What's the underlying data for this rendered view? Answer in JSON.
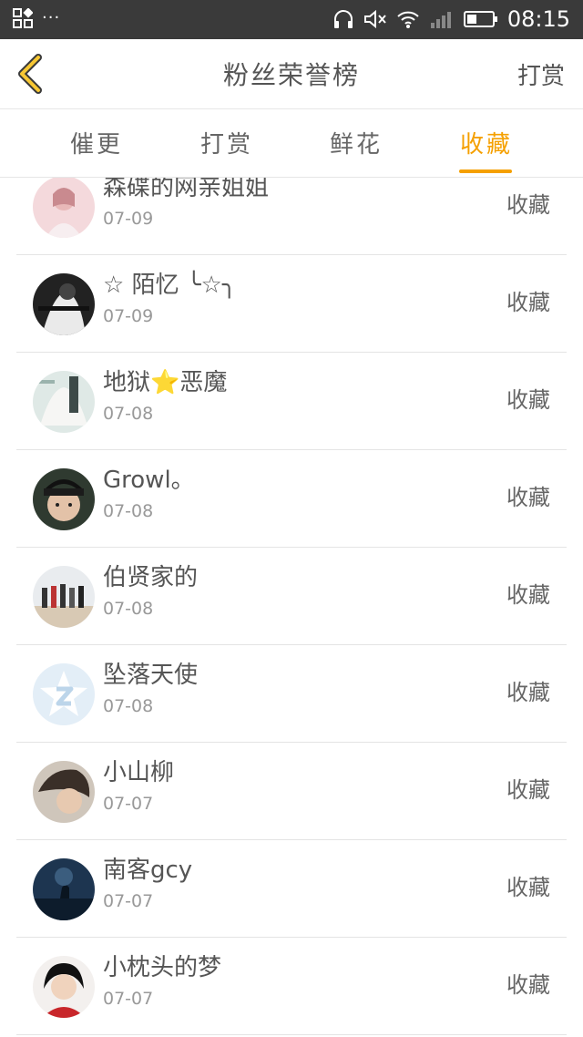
{
  "status_bar": {
    "time": "08:15",
    "left_dots": "···"
  },
  "header": {
    "title": "粉丝荣誉榜",
    "right_link": "打赏"
  },
  "tabs": [
    {
      "label": "催更"
    },
    {
      "label": "打赏"
    },
    {
      "label": "鲜花"
    },
    {
      "label": "收藏"
    }
  ],
  "active_tab": "收藏",
  "colors": {
    "accent": "#f5a000",
    "status_bar": "#3a3a3a"
  },
  "rows": [
    {
      "name": "森碟的网亲姐姐",
      "date": "07-09",
      "action": "收藏"
    },
    {
      "name": "☆ 陌忆 ╰☆╮",
      "date": "07-09",
      "action": "收藏"
    },
    {
      "name": "地狱⭐恶魔",
      "date": "07-08",
      "action": "收藏"
    },
    {
      "name": "Growl。",
      "date": "07-08",
      "action": "收藏"
    },
    {
      "name": "伯贤家的",
      "date": "07-08",
      "action": "收藏"
    },
    {
      "name": "坠落天使",
      "date": "07-08",
      "action": "收藏"
    },
    {
      "name": "小山柳",
      "date": "07-07",
      "action": "收藏"
    },
    {
      "name": "南客gcy",
      "date": "07-07",
      "action": "收藏"
    },
    {
      "name": "小枕头的梦",
      "date": "07-07",
      "action": "收藏"
    }
  ]
}
